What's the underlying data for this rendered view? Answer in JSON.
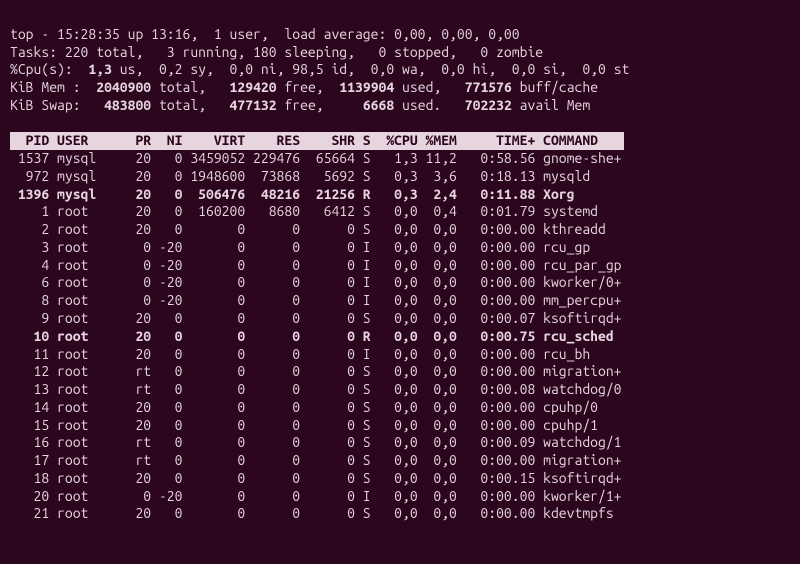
{
  "summary": {
    "line1": "top - 15:28:35 up 13:16,  1 user,  load average: 0,00, 0,00, 0,00",
    "tasks_text": "Tasks: 220 total,   3 running, 180 sleeping,   0 stopped,   0 zombie",
    "cpu_prefix": "%Cpu(s):  ",
    "cpu_us": "1,3",
    "cpu_rest": " us,  0,2 sy,  0,0 ni, 98,5 id,  0,0 wa,  0,0 hi,  0,0 si,  0,0 st",
    "mem_prefix": "KiB Mem :  ",
    "mem_total": "2040900",
    "mem_mid": " total,   ",
    "mem_free": "129420",
    "mem_mid2": " free,  ",
    "mem_used": "1139904",
    "mem_mid3": " used,   ",
    "mem_buff": "771576",
    "mem_suffix": " buff/cache",
    "swap_prefix": "KiB Swap:   ",
    "swap_total": "483800",
    "swap_mid": " total,   ",
    "swap_free": "477132",
    "swap_mid2": " free,     ",
    "swap_used": "6668",
    "swap_mid3": " used.   ",
    "swap_avail": "702232",
    "swap_suffix": " avail Mem"
  },
  "columns": "  PID USER      PR  NI    VIRT    RES    SHR S  %CPU %MEM     TIME+ COMMAND   ",
  "rows": [
    {
      "pid": " 1537",
      "user": "mysql",
      "pr": "20",
      "ni": "  0",
      "virt": "3459052",
      "res": "229476",
      "shr": "65664",
      "s": "S",
      "cpu": " 1,3",
      "mem": "11,2",
      "time": "0:58.56",
      "cmd": "gnome-she+",
      "bold": false
    },
    {
      "pid": "  972",
      "user": "mysql",
      "pr": "20",
      "ni": "  0",
      "virt": "1948600",
      "res": " 73868",
      "shr": " 5692",
      "s": "S",
      "cpu": " 0,3",
      "mem": " 3,6",
      "time": "0:18.13",
      "cmd": "mysqld",
      "bold": false
    },
    {
      "pid": " 1396",
      "user": "mysql",
      "pr": "20",
      "ni": "  0",
      "virt": " 506476",
      "res": " 48216",
      "shr": "21256",
      "s": "R",
      "cpu": " 0,3",
      "mem": " 2,4",
      "time": "0:11.88",
      "cmd": "Xorg",
      "bold": true
    },
    {
      "pid": "    1",
      "user": "root ",
      "pr": "20",
      "ni": "  0",
      "virt": " 160200",
      "res": "  8680",
      "shr": " 6412",
      "s": "S",
      "cpu": " 0,0",
      "mem": " 0,4",
      "time": "0:01.79",
      "cmd": "systemd",
      "bold": false
    },
    {
      "pid": "    2",
      "user": "root ",
      "pr": "20",
      "ni": "  0",
      "virt": "      0",
      "res": "     0",
      "shr": "    0",
      "s": "S",
      "cpu": " 0,0",
      "mem": " 0,0",
      "time": "0:00.00",
      "cmd": "kthreadd",
      "bold": false
    },
    {
      "pid": "    3",
      "user": "root ",
      "pr": " 0",
      "ni": "-20",
      "virt": "      0",
      "res": "     0",
      "shr": "    0",
      "s": "I",
      "cpu": " 0,0",
      "mem": " 0,0",
      "time": "0:00.00",
      "cmd": "rcu_gp",
      "bold": false
    },
    {
      "pid": "    4",
      "user": "root ",
      "pr": " 0",
      "ni": "-20",
      "virt": "      0",
      "res": "     0",
      "shr": "    0",
      "s": "I",
      "cpu": " 0,0",
      "mem": " 0,0",
      "time": "0:00.00",
      "cmd": "rcu_par_gp",
      "bold": false
    },
    {
      "pid": "    6",
      "user": "root ",
      "pr": " 0",
      "ni": "-20",
      "virt": "      0",
      "res": "     0",
      "shr": "    0",
      "s": "I",
      "cpu": " 0,0",
      "mem": " 0,0",
      "time": "0:00.00",
      "cmd": "kworker/0+",
      "bold": false
    },
    {
      "pid": "    8",
      "user": "root ",
      "pr": " 0",
      "ni": "-20",
      "virt": "      0",
      "res": "     0",
      "shr": "    0",
      "s": "I",
      "cpu": " 0,0",
      "mem": " 0,0",
      "time": "0:00.00",
      "cmd": "mm_percpu+",
      "bold": false
    },
    {
      "pid": "    9",
      "user": "root ",
      "pr": "20",
      "ni": "  0",
      "virt": "      0",
      "res": "     0",
      "shr": "    0",
      "s": "S",
      "cpu": " 0,0",
      "mem": " 0,0",
      "time": "0:00.07",
      "cmd": "ksoftirqd+",
      "bold": false
    },
    {
      "pid": "   10",
      "user": "root ",
      "pr": "20",
      "ni": "  0",
      "virt": "      0",
      "res": "     0",
      "shr": "    0",
      "s": "R",
      "cpu": " 0,0",
      "mem": " 0,0",
      "time": "0:00.75",
      "cmd": "rcu_sched",
      "bold": true
    },
    {
      "pid": "   11",
      "user": "root ",
      "pr": "20",
      "ni": "  0",
      "virt": "      0",
      "res": "     0",
      "shr": "    0",
      "s": "I",
      "cpu": " 0,0",
      "mem": " 0,0",
      "time": "0:00.00",
      "cmd": "rcu_bh",
      "bold": false
    },
    {
      "pid": "   12",
      "user": "root ",
      "pr": "rt",
      "ni": "  0",
      "virt": "      0",
      "res": "     0",
      "shr": "    0",
      "s": "S",
      "cpu": " 0,0",
      "mem": " 0,0",
      "time": "0:00.00",
      "cmd": "migration+",
      "bold": false
    },
    {
      "pid": "   13",
      "user": "root ",
      "pr": "rt",
      "ni": "  0",
      "virt": "      0",
      "res": "     0",
      "shr": "    0",
      "s": "S",
      "cpu": " 0,0",
      "mem": " 0,0",
      "time": "0:00.08",
      "cmd": "watchdog/0",
      "bold": false
    },
    {
      "pid": "   14",
      "user": "root ",
      "pr": "20",
      "ni": "  0",
      "virt": "      0",
      "res": "     0",
      "shr": "    0",
      "s": "S",
      "cpu": " 0,0",
      "mem": " 0,0",
      "time": "0:00.00",
      "cmd": "cpuhp/0",
      "bold": false
    },
    {
      "pid": "   15",
      "user": "root ",
      "pr": "20",
      "ni": "  0",
      "virt": "      0",
      "res": "     0",
      "shr": "    0",
      "s": "S",
      "cpu": " 0,0",
      "mem": " 0,0",
      "time": "0:00.00",
      "cmd": "cpuhp/1",
      "bold": false
    },
    {
      "pid": "   16",
      "user": "root ",
      "pr": "rt",
      "ni": "  0",
      "virt": "      0",
      "res": "     0",
      "shr": "    0",
      "s": "S",
      "cpu": " 0,0",
      "mem": " 0,0",
      "time": "0:00.09",
      "cmd": "watchdog/1",
      "bold": false
    },
    {
      "pid": "   17",
      "user": "root ",
      "pr": "rt",
      "ni": "  0",
      "virt": "      0",
      "res": "     0",
      "shr": "    0",
      "s": "S",
      "cpu": " 0,0",
      "mem": " 0,0",
      "time": "0:00.00",
      "cmd": "migration+",
      "bold": false
    },
    {
      "pid": "   18",
      "user": "root ",
      "pr": "20",
      "ni": "  0",
      "virt": "      0",
      "res": "     0",
      "shr": "    0",
      "s": "S",
      "cpu": " 0,0",
      "mem": " 0,0",
      "time": "0:00.15",
      "cmd": "ksoftirqd+",
      "bold": false
    },
    {
      "pid": "   20",
      "user": "root ",
      "pr": " 0",
      "ni": "-20",
      "virt": "      0",
      "res": "     0",
      "shr": "    0",
      "s": "I",
      "cpu": " 0,0",
      "mem": " 0,0",
      "time": "0:00.00",
      "cmd": "kworker/1+",
      "bold": false
    },
    {
      "pid": "   21",
      "user": "root ",
      "pr": "20",
      "ni": "  0",
      "virt": "      0",
      "res": "     0",
      "shr": "    0",
      "s": "S",
      "cpu": " 0,0",
      "mem": " 0,0",
      "time": "0:00.00",
      "cmd": "kdevtmpfs",
      "bold": false
    }
  ]
}
